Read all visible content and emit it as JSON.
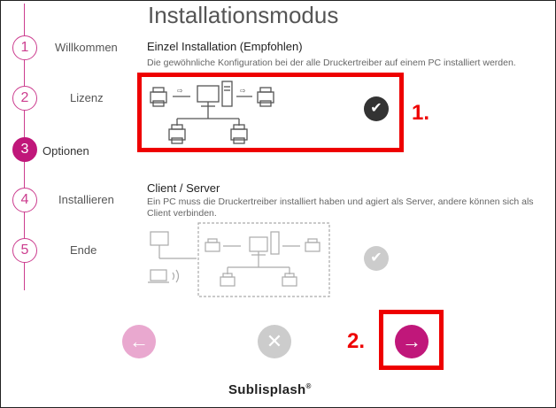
{
  "page": {
    "title": "Installationsmodus"
  },
  "steps": [
    {
      "number": "1",
      "label": "Willkommen"
    },
    {
      "number": "2",
      "label": "Lizenz"
    },
    {
      "number": "3",
      "label": "Optionen"
    },
    {
      "number": "4",
      "label": "Installieren"
    },
    {
      "number": "5",
      "label": "Ende"
    }
  ],
  "options": {
    "single": {
      "title": "Einzel Installation (Empfohlen)",
      "description": "Die gewöhnliche Konfiguration bei der alle Druckertreiber auf einem PC installiert werden.",
      "check_icon": "check-icon"
    },
    "client_server": {
      "title": "Client / Server",
      "description": "Ein PC muss die Druckertreiber installiert haben und agiert als Server, andere können sich als Client verbinden.",
      "check_icon": "check-icon"
    }
  },
  "annotations": {
    "first": "1.",
    "second": "2."
  },
  "nav": {
    "back_icon": "arrow-left-icon",
    "cancel_icon": "close-icon",
    "next_icon": "arrow-right-icon"
  },
  "brand": {
    "name": "Sublisplash",
    "mark": "®"
  },
  "colors": {
    "accent": "#c0177a",
    "accent_light": "#e9a8cf",
    "annotation": "#ee0000",
    "disabled": "#cccccc"
  }
}
